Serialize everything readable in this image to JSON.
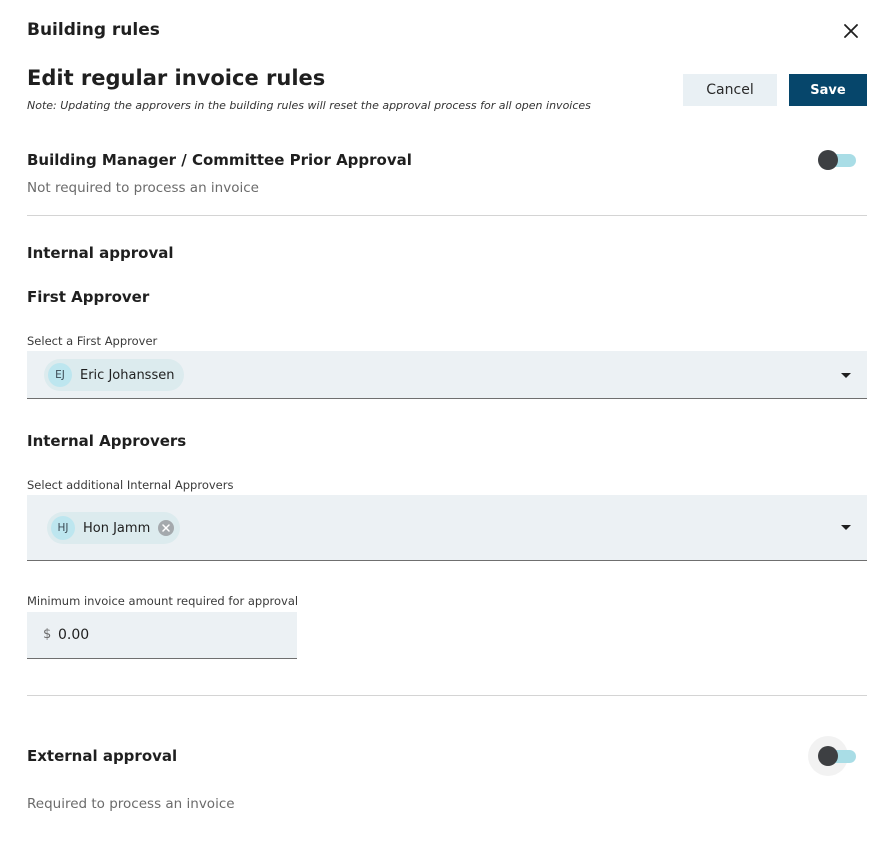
{
  "dialog": {
    "title": "Building rules",
    "close_icon": "close-icon"
  },
  "header": {
    "title": "Edit regular invoice rules",
    "note": "Note: Updating the approvers in the building rules will reset the approval process for all open invoices",
    "cancel_label": "Cancel",
    "save_label": "Save"
  },
  "prior_approval": {
    "title": "Building Manager / Committee Prior Approval",
    "status": "Not required to process an invoice",
    "enabled": false
  },
  "internal": {
    "title": "Internal approval",
    "first_approver": {
      "heading": "First Approver",
      "label": "Select a First Approver",
      "selected": {
        "initials": "EJ",
        "name": "Eric Johanssen"
      }
    },
    "internal_approvers": {
      "heading": "Internal Approvers",
      "label": "Select additional Internal Approvers",
      "selected": [
        {
          "initials": "HJ",
          "name": "Hon Jamm"
        }
      ]
    },
    "minimum_amount": {
      "label": "Minimum invoice amount required for approval",
      "currency": "$",
      "value": "0.00"
    }
  },
  "external": {
    "title": "External approval",
    "status": "Required to process an invoice",
    "enabled": false
  },
  "colors": {
    "primary": "#06466b",
    "toggle_track": "#a9dde6",
    "toggle_thumb": "#3d3f42",
    "field_bg": "#ecf1f4",
    "chip_bg": "#dcebee",
    "avatar_bg": "#bde6ef"
  }
}
